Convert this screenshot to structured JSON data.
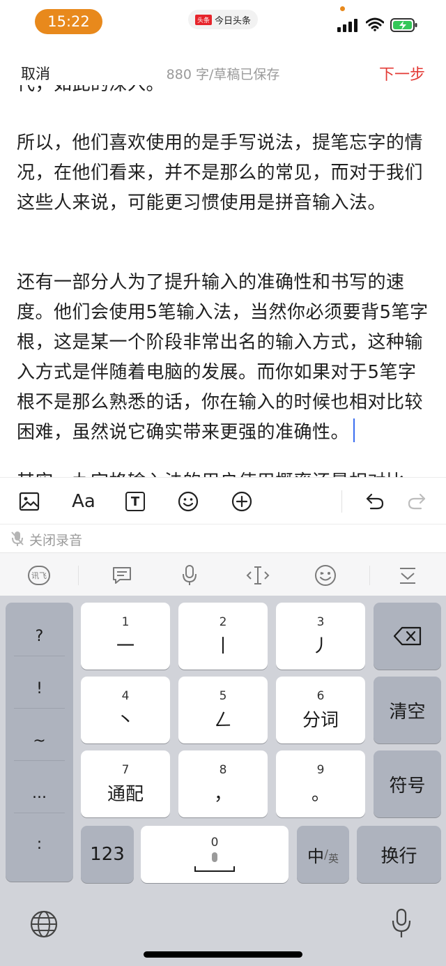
{
  "status_bar": {
    "time": "15:22",
    "app_name": "今日头条",
    "app_logo_text": "头条"
  },
  "header": {
    "cancel_label": "取消",
    "status_text": "880 字/草稿已保存",
    "next_label": "下一步"
  },
  "editor": {
    "paragraphs": [
      "代，如此的深入。",
      "所以，他们喜欢使用的是手写说法，提笔忘字的情况，在他们看来，并不是那么的常见，而对于我们这些人来说，可能更习惯使用是拼音输入法。",
      "还有一部分人为了提升输入的准确性和书写的速度。他们会使用5笔输入法，当然你必须要背5笔字根，这是某一个阶段非常出名的输入方式，这种输入方式是伴随着电脑的发展。而你如果对于5笔字根不是那么熟悉的话，你在输入的时候也相对比较困难，虽然说它确实带来更强的准确性。",
      "其实，九宫格输入法的用户使用概率还是相对比"
    ]
  },
  "toolbar": {
    "icons": [
      "image-icon",
      "font-icon",
      "text-box-icon",
      "emoji-icon",
      "add-icon",
      "undo-icon",
      "redo-icon"
    ],
    "font_label": "Aa",
    "text_box_label": "T"
  },
  "voice": {
    "label": "关闭录音"
  },
  "ime_toolbar": {
    "logo_text": "讯飞"
  },
  "keyboard": {
    "symbols": [
      "?",
      "!",
      "~",
      "...",
      ":"
    ],
    "keys": [
      {
        "num": "1",
        "label": "一"
      },
      {
        "num": "2",
        "label": "丨"
      },
      {
        "num": "3",
        "label": "丿"
      },
      {
        "num": "4",
        "label": "丶"
      },
      {
        "num": "5",
        "label": "ㄥ"
      },
      {
        "num": "6",
        "label": "分词"
      },
      {
        "num": "7",
        "label": "通配"
      },
      {
        "num": "8",
        "label": "，"
      },
      {
        "num": "9",
        "label": "。"
      }
    ],
    "clear_label": "清空",
    "symbol_label": "符号",
    "num_label": "123",
    "space_num": "0",
    "lang_main": "中",
    "lang_sub": "英",
    "enter_label": "换行"
  }
}
